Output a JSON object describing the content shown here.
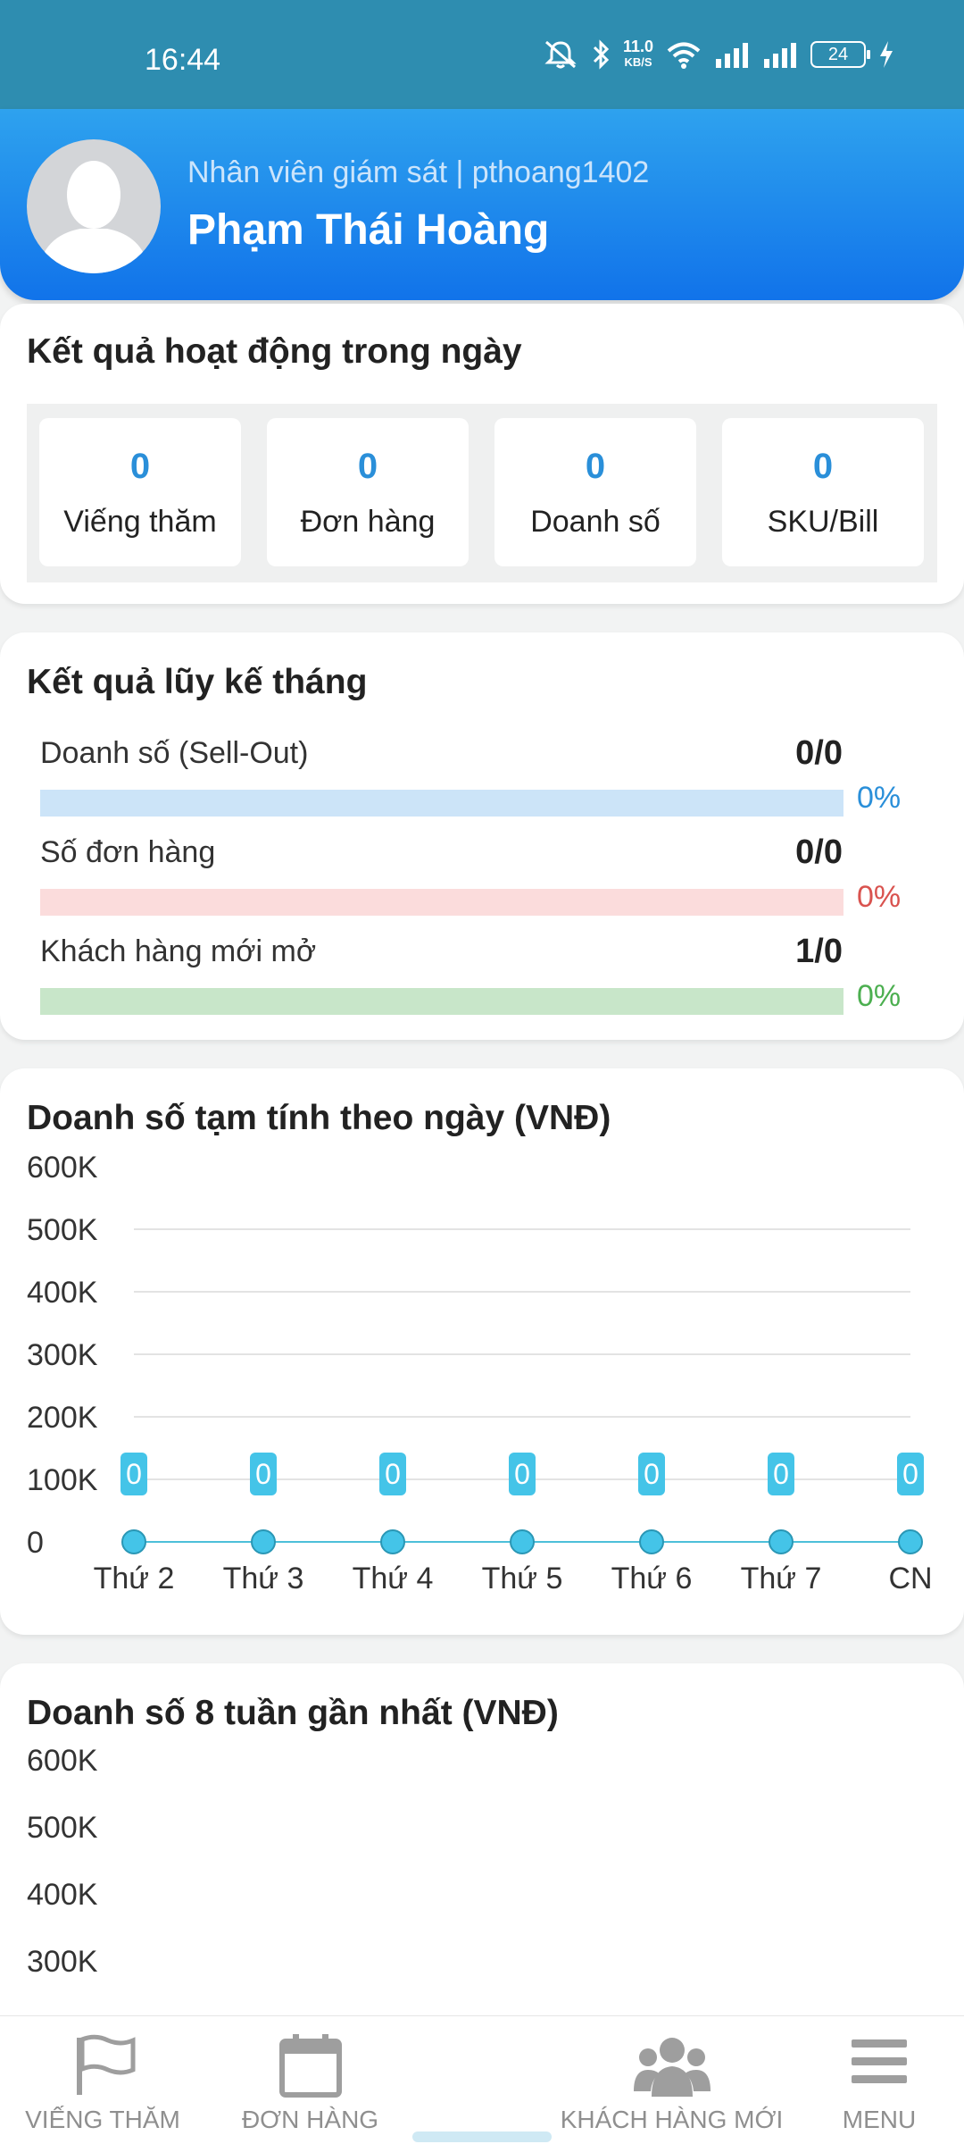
{
  "status_bar": {
    "time": "16:44",
    "net_speed_value": "11.0",
    "net_speed_unit": "KB/S",
    "battery": "24",
    "icons": [
      "mute-icon",
      "bluetooth-icon",
      "wifi-icon",
      "signal-icon",
      "signal-icon",
      "battery-icon",
      "charging-icon"
    ]
  },
  "header": {
    "subtitle": "Nhân viên giám sát | pthoang1402",
    "name": "Phạm Thái Hoàng"
  },
  "daily": {
    "title": "Kết quả hoạt động trong ngày",
    "items": [
      {
        "value": "0",
        "label": "Viếng thăm"
      },
      {
        "value": "0",
        "label": "Đơn hàng"
      },
      {
        "value": "0",
        "label": "Doanh số"
      },
      {
        "value": "0",
        "label": "SKU/Bill"
      }
    ]
  },
  "monthly": {
    "title": "Kết quả lũy kế tháng",
    "rows": [
      {
        "label": "Doanh số (Sell-Out)",
        "value": "0/0",
        "percent": "0%",
        "progress": 0,
        "bar_color": "#cce4f8",
        "pct_color": "#2a8fd9"
      },
      {
        "label": "Số đơn hàng",
        "value": "0/0",
        "percent": "0%",
        "progress": 0,
        "bar_color": "#fbdcdc",
        "pct_color": "#d9534f"
      },
      {
        "label": "Khách hàng mới mở",
        "value": "1/0",
        "percent": "0%",
        "progress": 0,
        "bar_color": "#c8e6c9",
        "pct_color": "#4caf50"
      }
    ]
  },
  "daily_chart": {
    "title": "Doanh số tạm tính theo ngày (VNĐ)"
  },
  "weekly_chart": {
    "title": "Doanh số 8 tuần gần nhất (VNĐ)",
    "visible_ticks": [
      "600K",
      "500K",
      "400K",
      "300K"
    ]
  },
  "chart_data": [
    {
      "type": "line",
      "title": "Doanh số tạm tính theo ngày (VNĐ)",
      "categories": [
        "Thứ 2",
        "Thứ 3",
        "Thứ 4",
        "Thứ 5",
        "Thứ 6",
        "Thứ 7",
        "CN"
      ],
      "values": [
        0,
        0,
        0,
        0,
        0,
        0,
        0
      ],
      "data_labels": [
        "0",
        "0",
        "0",
        "0",
        "0",
        "0",
        "0"
      ],
      "y_ticks": [
        "0",
        "100K",
        "200K",
        "300K",
        "400K",
        "500K",
        "600K"
      ],
      "ylim": [
        0,
        600000
      ],
      "grid": true,
      "line_color": "#4dbfd9",
      "point_color": "#44c4e8"
    }
  ],
  "bottom_nav": {
    "items": [
      {
        "label": "VIẾNG THĂM",
        "icon": "flag-icon"
      },
      {
        "label": "ĐƠN HÀNG",
        "icon": "calendar-icon"
      },
      {
        "label": "KHÁCH HÀNG MỚI",
        "icon": "users-icon"
      },
      {
        "label": "MENU",
        "icon": "menu-icon"
      }
    ]
  }
}
